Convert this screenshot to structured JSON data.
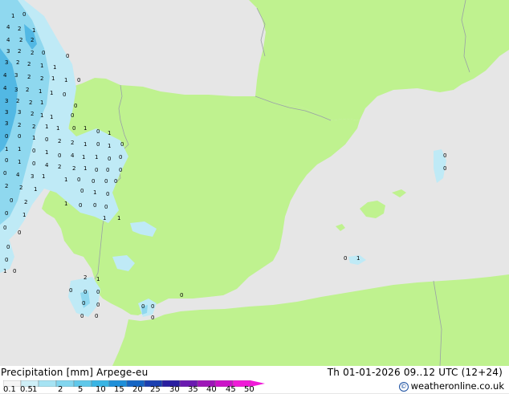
{
  "header": {
    "title": "Precipitation [mm]  Arpege-eu",
    "datetime": "Th 01-01-2026 09..12 UTC (12+24)",
    "credit": "weatheronline.co.uk"
  },
  "scale": {
    "labels": [
      "0.1",
      "0.5",
      "1",
      "2",
      "5",
      "10",
      "15",
      "20",
      "25",
      "30",
      "35",
      "40",
      "45",
      "50"
    ],
    "colors": [
      "#f5f5f5",
      "#cfeff7",
      "#a6e3f3",
      "#82d6ef",
      "#5fc8ea",
      "#3ab5e4",
      "#1e8fd9",
      "#1565c4",
      "#1a3fb0",
      "#2a1fa0",
      "#6a1ab0",
      "#9e16b8",
      "#cc12c8",
      "#f01ad8"
    ]
  },
  "colors": {
    "land": "#bff28f",
    "sea": "#e6e6e6",
    "border": "#99a1a6",
    "rain_light": "#bfeaf6",
    "rain_mid": "#8fd8ef",
    "rain_heavy": "#52b8e4"
  },
  "map_values": [
    "1",
    "0",
    "4",
    "2",
    "1",
    "4",
    "2",
    "2",
    "3",
    "2",
    "2",
    "0",
    "3",
    "2",
    "2",
    "1",
    "1",
    "0",
    "4",
    "3",
    "2",
    "2",
    "1",
    "1",
    "0",
    "4",
    "3",
    "2",
    "1",
    "1",
    "0",
    "3",
    "2",
    "2",
    "1",
    "0",
    "3",
    "3",
    "2",
    "1",
    "1",
    "0",
    "3",
    "2",
    "2",
    "1",
    "1",
    "0",
    "1",
    "0",
    "1",
    "0",
    "0",
    "1",
    "0",
    "2",
    "2",
    "1",
    "0",
    "1",
    "0",
    "1",
    "1",
    "0",
    "1",
    "0",
    "4",
    "1",
    "1",
    "0",
    "0",
    "0",
    "1",
    "0",
    "4",
    "2",
    "2",
    "1",
    "0",
    "0",
    "0",
    "0",
    "4",
    "3",
    "1",
    "1",
    "0",
    "0",
    "0",
    "0",
    "2",
    "2",
    "1",
    "0",
    "1",
    "0",
    "0",
    "2",
    "1",
    "0",
    "0",
    "0",
    "0",
    "1",
    "1",
    "1",
    "0",
    "0",
    "0",
    "0",
    "1",
    "0",
    "2",
    "1",
    "0",
    "0",
    "0",
    "0",
    "0",
    "0",
    "0",
    "0",
    "0",
    "0",
    "0",
    "0",
    "0",
    "0",
    "1",
    "0",
    "1",
    "1",
    "0"
  ]
}
